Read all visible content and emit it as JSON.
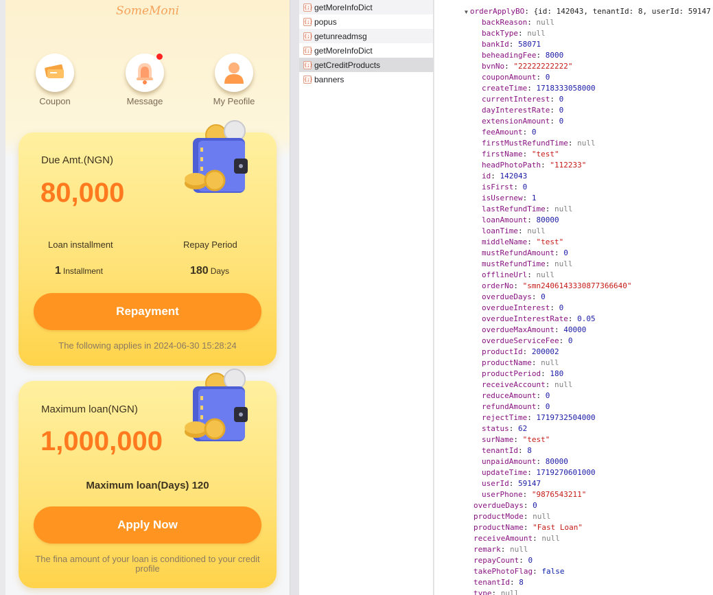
{
  "app": {
    "brand": "SomeMoni",
    "quick_actions": [
      {
        "label": "Coupon",
        "icon": "coupon-icon",
        "badge": false
      },
      {
        "label": "Message",
        "icon": "bell-icon",
        "badge": true
      },
      {
        "label": "My Peofile",
        "icon": "user-icon",
        "badge": false
      }
    ],
    "due_card": {
      "title": "Due Amt.(NGN)",
      "amount": "80,000",
      "installment_label": "Loan installment",
      "installment_value": "1",
      "installment_unit": "Installment",
      "period_label": "Repay Period",
      "period_value": "180",
      "period_unit": "Days",
      "button": "Repayment",
      "footnote": "The following applies in 2024-06-30 15:28:24"
    },
    "loan_card": {
      "title": "Maximum loan(NGN)",
      "amount": "1,000,000",
      "days_text": "Maximum loan(Days) 120",
      "button": "Apply Now",
      "footnote": "The fina amount of your loan is conditioned to your credit profile"
    },
    "colors": {
      "accent": "#ff9420",
      "amount": "#ff7a1f",
      "card": "#ffe37a"
    }
  },
  "network": {
    "requests": [
      {
        "name": "getMoreInfoDict",
        "state": "alt"
      },
      {
        "name": "popus",
        "state": ""
      },
      {
        "name": "getunreadmsg",
        "state": "alt"
      },
      {
        "name": "getMoreInfoDict",
        "state": ""
      },
      {
        "name": "getCreditProducts",
        "state": "sel"
      },
      {
        "name": "banners",
        "state": ""
      }
    ],
    "icon_glyph": "{;}"
  },
  "preview": {
    "header": {
      "key": "orderApplyBO",
      "summary": "{id: 142043, tenantId: 8, userId: 59147"
    },
    "fields": [
      {
        "k": "backReason",
        "v": "null",
        "t": "nul"
      },
      {
        "k": "backType",
        "v": "null",
        "t": "nul"
      },
      {
        "k": "bankId",
        "v": "58071",
        "t": "n"
      },
      {
        "k": "beheadingFee",
        "v": "8000",
        "t": "n"
      },
      {
        "k": "bvnNo",
        "v": "\"22222222222\"",
        "t": "s"
      },
      {
        "k": "couponAmount",
        "v": "0",
        "t": "n"
      },
      {
        "k": "createTime",
        "v": "1718333058000",
        "t": "n"
      },
      {
        "k": "currentInterest",
        "v": "0",
        "t": "n"
      },
      {
        "k": "dayInterestRate",
        "v": "0",
        "t": "n"
      },
      {
        "k": "extensionAmount",
        "v": "0",
        "t": "n"
      },
      {
        "k": "feeAmount",
        "v": "0",
        "t": "n"
      },
      {
        "k": "firstMustRefundTime",
        "v": "null",
        "t": "nul"
      },
      {
        "k": "firstName",
        "v": "\"test\"",
        "t": "s"
      },
      {
        "k": "headPhotoPath",
        "v": "\"112233\"",
        "t": "s"
      },
      {
        "k": "id",
        "v": "142043",
        "t": "n"
      },
      {
        "k": "isFirst",
        "v": "0",
        "t": "n"
      },
      {
        "k": "isUsernew",
        "v": "1",
        "t": "n"
      },
      {
        "k": "lastRefundTime",
        "v": "null",
        "t": "nul"
      },
      {
        "k": "loanAmount",
        "v": "80000",
        "t": "n"
      },
      {
        "k": "loanTime",
        "v": "null",
        "t": "nul"
      },
      {
        "k": "middleName",
        "v": "\"test\"",
        "t": "s"
      },
      {
        "k": "mustRefundAmount",
        "v": "0",
        "t": "n"
      },
      {
        "k": "mustRefundTime",
        "v": "null",
        "t": "nul"
      },
      {
        "k": "offlineUrl",
        "v": "null",
        "t": "nul"
      },
      {
        "k": "orderNo",
        "v": "\"smn2406143330877366640\"",
        "t": "s"
      },
      {
        "k": "overdueDays",
        "v": "0",
        "t": "n"
      },
      {
        "k": "overdueInterest",
        "v": "0",
        "t": "n"
      },
      {
        "k": "overdueInterestRate",
        "v": "0.05",
        "t": "n"
      },
      {
        "k": "overdueMaxAmount",
        "v": "40000",
        "t": "n"
      },
      {
        "k": "overdueServiceFee",
        "v": "0",
        "t": "n"
      },
      {
        "k": "productId",
        "v": "200002",
        "t": "n"
      },
      {
        "k": "productName",
        "v": "null",
        "t": "nul"
      },
      {
        "k": "productPeriod",
        "v": "180",
        "t": "n"
      },
      {
        "k": "receiveAccount",
        "v": "null",
        "t": "nul"
      },
      {
        "k": "reduceAmount",
        "v": "0",
        "t": "n"
      },
      {
        "k": "refundAmount",
        "v": "0",
        "t": "n"
      },
      {
        "k": "rejectTime",
        "v": "1719732504000",
        "t": "n"
      },
      {
        "k": "status",
        "v": "62",
        "t": "n"
      },
      {
        "k": "surName",
        "v": "\"test\"",
        "t": "s"
      },
      {
        "k": "tenantId",
        "v": "8",
        "t": "n"
      },
      {
        "k": "unpaidAmount",
        "v": "80000",
        "t": "n"
      },
      {
        "k": "updateTime",
        "v": "1719270601000",
        "t": "n"
      },
      {
        "k": "userId",
        "v": "59147",
        "t": "n"
      },
      {
        "k": "userPhone",
        "v": "\"9876543211\"",
        "t": "s"
      }
    ],
    "outer_fields": [
      {
        "k": "overdueDays",
        "v": "0",
        "t": "n"
      },
      {
        "k": "productMode",
        "v": "null",
        "t": "nul"
      },
      {
        "k": "productName",
        "v": "\"Fast Loan\"",
        "t": "s"
      },
      {
        "k": "receiveAmount",
        "v": "null",
        "t": "nul"
      },
      {
        "k": "remark",
        "v": "null",
        "t": "nul"
      },
      {
        "k": "repayCount",
        "v": "0",
        "t": "n"
      },
      {
        "k": "takePhotoFlag",
        "v": "false",
        "t": "b"
      },
      {
        "k": "tenantId",
        "v": "8",
        "t": "n"
      },
      {
        "k": "type",
        "v": "null",
        "t": "nul"
      }
    ]
  }
}
